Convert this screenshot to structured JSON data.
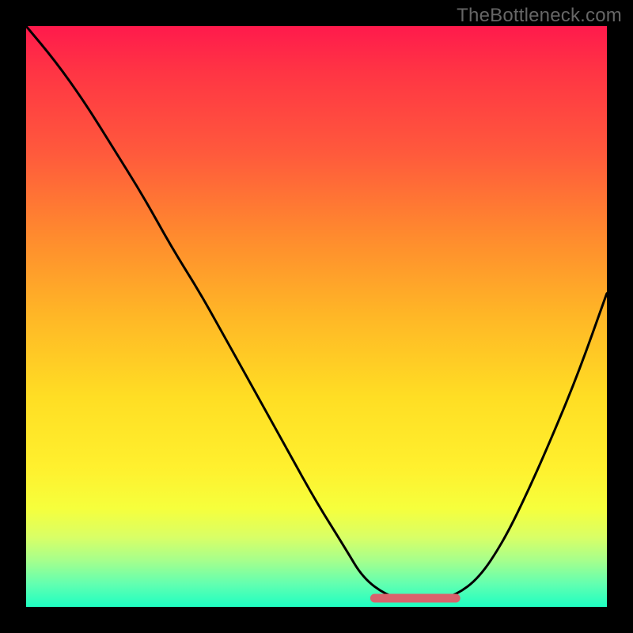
{
  "watermark": "TheBottleneck.com",
  "colors": {
    "frame": "#000000",
    "gradient_top": "#ff1a4c",
    "gradient_mid": "#ffde24",
    "gradient_bottom": "#1effc2",
    "curve": "#000000",
    "marker": "#d9636c"
  },
  "chart_data": {
    "type": "line",
    "title": "",
    "xlabel": "",
    "ylabel": "",
    "xlim": [
      0,
      100
    ],
    "ylim": [
      0,
      100
    ],
    "grid": false,
    "legend": false,
    "note": "x and y values are in percent of the plot area; y is the curve height above the bottom edge (0 = bottom, 100 = top). Values are estimated from pixels since the chart has no numeric axes.",
    "series": [
      {
        "name": "bottleneck-curve",
        "x": [
          0,
          5,
          10,
          15,
          20,
          25,
          30,
          35,
          40,
          45,
          50,
          55,
          58,
          62,
          66,
          70,
          74,
          78,
          82,
          86,
          90,
          95,
          100
        ],
        "y": [
          100,
          94,
          87,
          79,
          71,
          62,
          54,
          45,
          36,
          27,
          18,
          10,
          5,
          2,
          1,
          1,
          2,
          5,
          11,
          19,
          28,
          40,
          54
        ]
      }
    ],
    "trough_marker": {
      "name": "optimal-band",
      "x_start": 60,
      "x_end": 74,
      "y": 1.5,
      "color": "#d9636c"
    },
    "background_gradient_axis": "y",
    "background_gradient_meaning": "qualitative severity: red=high, green=low"
  }
}
